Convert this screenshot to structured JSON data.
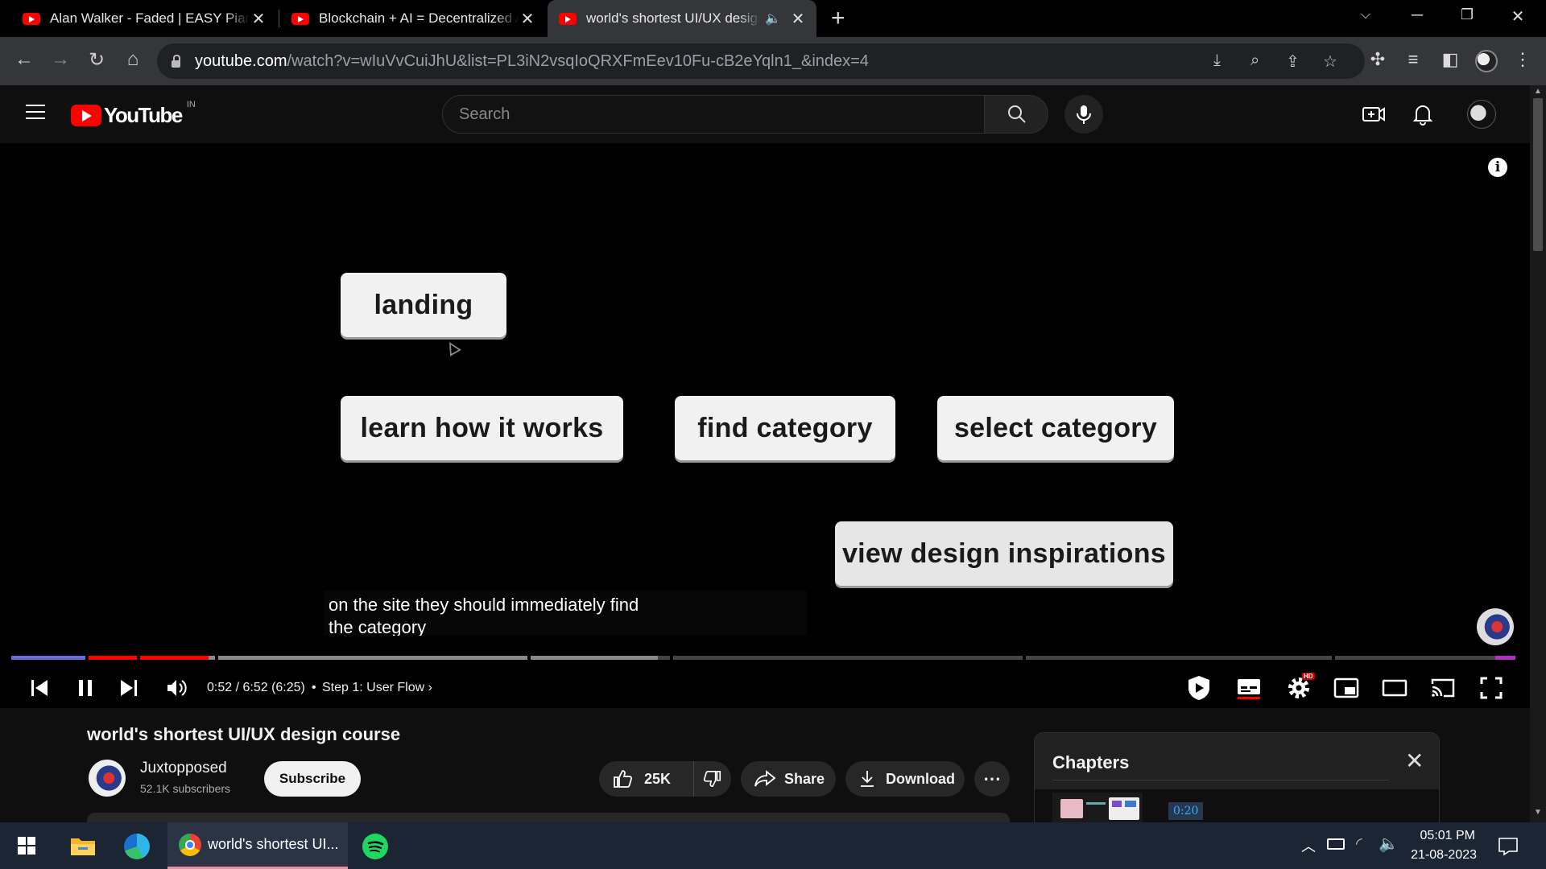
{
  "browser": {
    "tabs": [
      {
        "title": "Alan Walker - Faded | EASY Piano",
        "active": false
      },
      {
        "title": "Blockchain + AI = Decentralized AI",
        "active": false
      },
      {
        "title": "world's shortest UI/UX design course",
        "active": true
      }
    ],
    "url_host": "youtube.com",
    "url_path": "/watch?v=wIuVvCuiJhU&list=PL3iN2vsqIoQRXFmEev10Fu-cB2eYqln1_&index=4"
  },
  "youtube": {
    "logo_text": "YouTube",
    "region": "IN",
    "search_placeholder": "Search"
  },
  "player": {
    "flow_boxes": [
      "landing",
      "learn how it works",
      "find category",
      "select category",
      "view design inspirations"
    ],
    "captions": [
      "on the site they should immediately find",
      "the category"
    ],
    "time_display": "0:52 / 6:52 (6:25)",
    "chapter_separator": "•",
    "chapter": "Step 1: User Flow",
    "progress_fraction": 0.131,
    "buffered_fraction": 0.43,
    "settings_badge": "HD"
  },
  "video": {
    "title": "world's shortest UI/UX design course",
    "channel": "Juxtopposed",
    "subscribers": "52.1K subscribers",
    "subscribe_label": "Subscribe",
    "likes": "25K",
    "share_label": "Share",
    "download_label": "Download"
  },
  "chapters": {
    "title": "Chapters",
    "first_time": "0:20"
  },
  "taskbar": {
    "active_window": "world's shortest UI...",
    "time": "05:01 PM",
    "date": "21-08-2023"
  },
  "colors": {
    "youtube_red": "#ff0000",
    "progress_red": "#ff0000",
    "chapter_time_blue": "#3ea6ff"
  }
}
